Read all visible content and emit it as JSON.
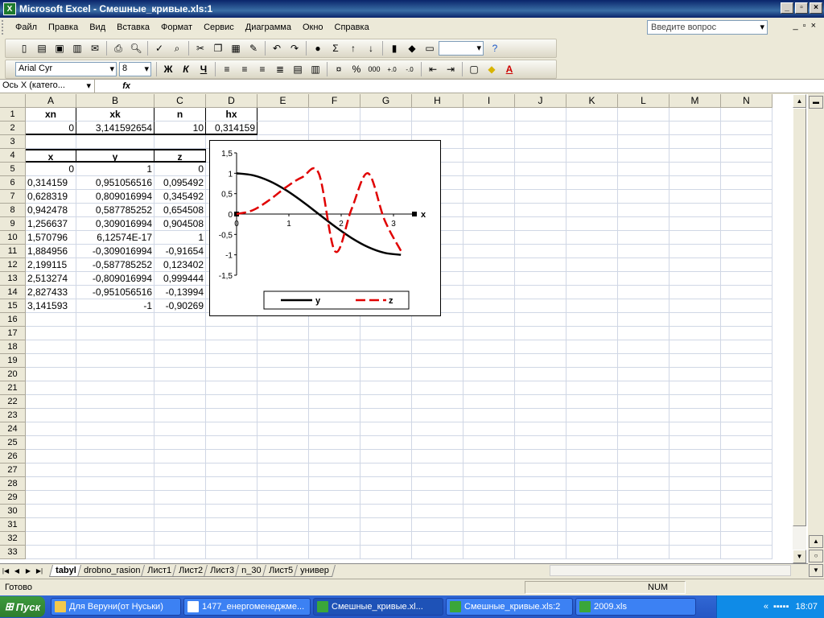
{
  "window": {
    "title": "Microsoft Excel - Смешные_кривые.xls:1"
  },
  "menu": [
    "Файл",
    "Правка",
    "Вид",
    "Вставка",
    "Формат",
    "Сервис",
    "Диаграмма",
    "Окно",
    "Справка"
  ],
  "help_placeholder": "Введите вопрос",
  "font": {
    "name": "Arial Cyr",
    "size": "8"
  },
  "formula": {
    "name_box": "Ось X (катего...",
    "fx": "fx"
  },
  "columns": [
    "A",
    "B",
    "C",
    "D",
    "E",
    "F",
    "G",
    "H",
    "I",
    "J",
    "K",
    "L",
    "M",
    "N"
  ],
  "rows": [
    [
      "xn",
      "xk",
      "n",
      "hx"
    ],
    [
      "0",
      "3,141592654",
      "10",
      "0,314159"
    ],
    [
      "",
      "",
      "",
      ""
    ],
    [
      "x",
      "y",
      "z",
      ""
    ],
    [
      "0",
      "1",
      "0",
      ""
    ],
    [
      "0,314159",
      "0,951056516",
      "0,095492",
      ""
    ],
    [
      "0,628319",
      "0,809016994",
      "0,345492",
      ""
    ],
    [
      "0,942478",
      "0,587785252",
      "0,654508",
      ""
    ],
    [
      "1,256637",
      "0,309016994",
      "0,904508",
      ""
    ],
    [
      "1,570796",
      "6,12574E-17",
      "1",
      ""
    ],
    [
      "1,884956",
      "-0,309016994",
      "-0,91654",
      ""
    ],
    [
      "2,199115",
      "-0,587785252",
      "0,123402",
      ""
    ],
    [
      "2,513274",
      "-0,809016994",
      "0,999444",
      ""
    ],
    [
      "2,827433",
      "-0,951056516",
      "-0,13994",
      ""
    ],
    [
      "3,141593",
      "-1",
      "-0,90269",
      ""
    ]
  ],
  "row_count": 33,
  "chart_data": {
    "type": "line",
    "x": [
      0,
      0.314159,
      0.628319,
      0.942478,
      1.256637,
      1.570796,
      1.884956,
      2.199115,
      2.513274,
      2.827433,
      3.141593
    ],
    "series": [
      {
        "name": "y",
        "values": [
          1,
          0.951057,
          0.809017,
          0.587785,
          0.309017,
          6.12574e-17,
          -0.309017,
          -0.587785,
          -0.809017,
          -0.951057,
          -1
        ],
        "color": "#000000",
        "dash": "solid"
      },
      {
        "name": "z",
        "values": [
          0,
          0.095492,
          0.345492,
          0.654508,
          0.904508,
          1,
          -0.91654,
          0.123402,
          0.999444,
          -0.13994,
          -0.90269
        ],
        "color": "#e00000",
        "dash": "dashed"
      }
    ],
    "ylim": [
      -1.5,
      1.5
    ],
    "yticks": [
      "1,5",
      "1",
      "0,5",
      "0",
      "-0,5",
      "-1",
      "-1,5"
    ],
    "xticks": [
      "0",
      "1",
      "2",
      "3"
    ],
    "xlabel": "x",
    "legend": "bottom"
  },
  "sheet_tabs": [
    "tabyl",
    "drobno_rasion",
    "Лист1",
    "Лист2",
    "Лист3",
    "n_30",
    "Лист5",
    "универ"
  ],
  "status": {
    "ready": "Готово",
    "num": "NUM"
  },
  "taskbar": {
    "start": "Пуск",
    "tasks": [
      "Для Веруни(от Нуськи)",
      "1477_енергоменеджме...",
      "Смешные_кривые.xl...",
      "Смешные_кривые.xls:2",
      "2009.xls"
    ],
    "clock": "18:07"
  }
}
